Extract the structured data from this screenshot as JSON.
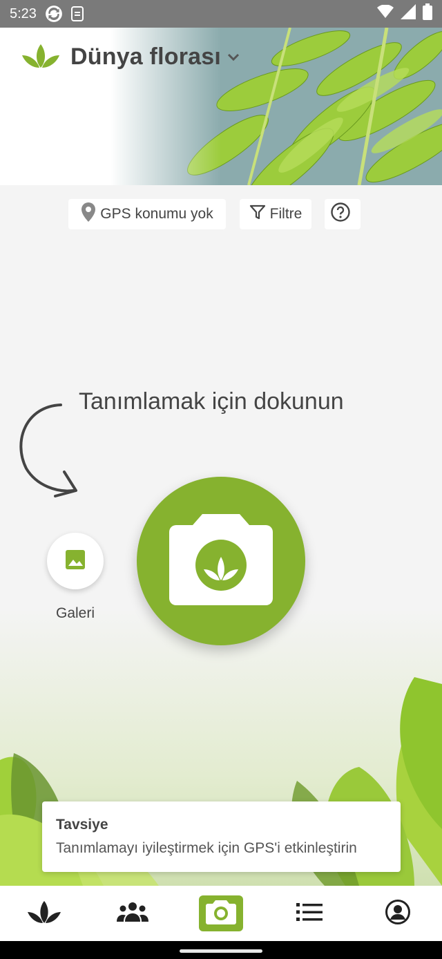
{
  "status_bar": {
    "time": "5:23"
  },
  "header": {
    "title": "Dünya florası"
  },
  "chips": {
    "gps_label": "GPS konumu yok",
    "filter_label": "Filtre"
  },
  "main": {
    "hint": "Tanımlamak için dokunun",
    "gallery_label": "Galeri"
  },
  "toast": {
    "title": "Tavsiye",
    "message": "Tanımlamayı iyileştirmek için GPS'i etkinleştirin"
  },
  "colors": {
    "accent": "#86b22f",
    "text": "#444444",
    "status_bar": "#7a7a7a"
  },
  "bottom_nav": {
    "items": [
      "plant-icon",
      "community-icon",
      "camera-icon",
      "list-icon",
      "account-icon"
    ]
  }
}
